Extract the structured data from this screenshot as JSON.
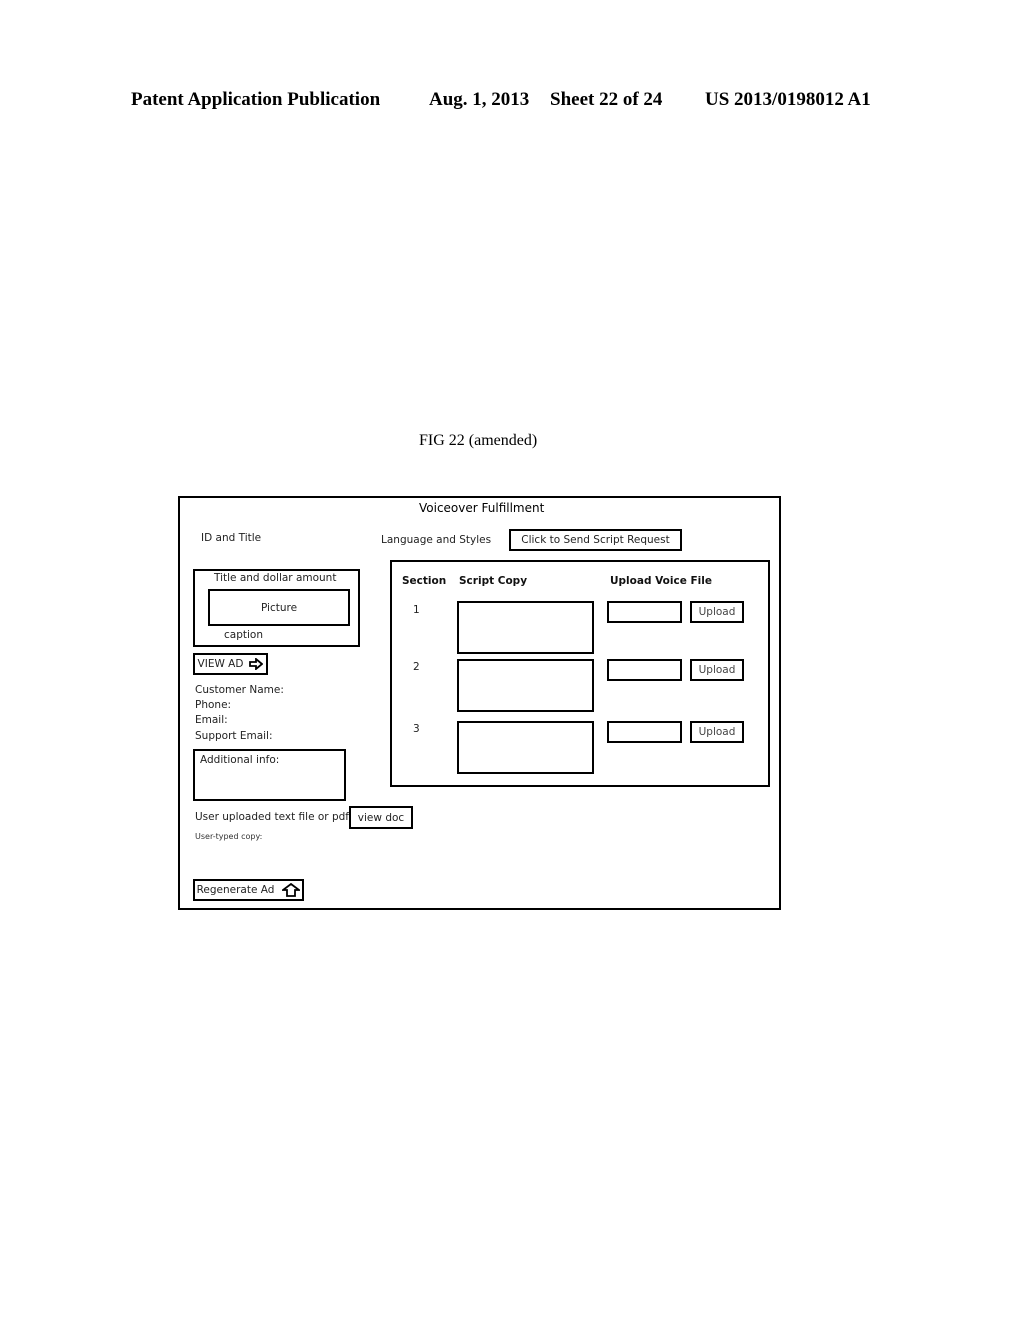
{
  "page_header": {
    "publication": "Patent Application Publication",
    "date": "Aug. 1, 2013",
    "sheet": "Sheet 22 of 24",
    "number": "US 2013/0198012 A1"
  },
  "figure_caption": "FIG 22 (amended)",
  "ui": {
    "title": "Voiceover Fulfillment",
    "id_and_title_label": "ID and Title",
    "language_styles_label": "Language and Styles",
    "send_script_button": "Click to Send Script Request",
    "ad_preview": {
      "title_label": "Title and dollar amount",
      "picture_label": "Picture",
      "caption_label": "caption"
    },
    "view_ad_button": "VIEW AD",
    "customer_info": {
      "name_label": "Customer Name:",
      "phone_label": "Phone:",
      "email_label": "Email:",
      "support_email_label": "Support Email:"
    },
    "additional_info_label": "Additional info:",
    "uploaded_file_label": "User uploaded text file or pdf:",
    "view_doc_button": "view doc",
    "user_typed_copy_label": "User-typed copy:",
    "regenerate_button": "Regenerate Ad",
    "sections_panel": {
      "headers": {
        "section": "Section",
        "script_copy": "Script Copy",
        "upload_voice_file": "Upload Voice File"
      },
      "rows": [
        {
          "number": "1",
          "script_copy": "",
          "voice_file": "",
          "upload_label": "Upload"
        },
        {
          "number": "2",
          "script_copy": "",
          "voice_file": "",
          "upload_label": "Upload"
        },
        {
          "number": "3",
          "script_copy": "",
          "voice_file": "",
          "upload_label": "Upload"
        }
      ]
    },
    "icons": {
      "view_ad": "arrow-right-icon",
      "regenerate": "arrow-up-icon"
    }
  }
}
